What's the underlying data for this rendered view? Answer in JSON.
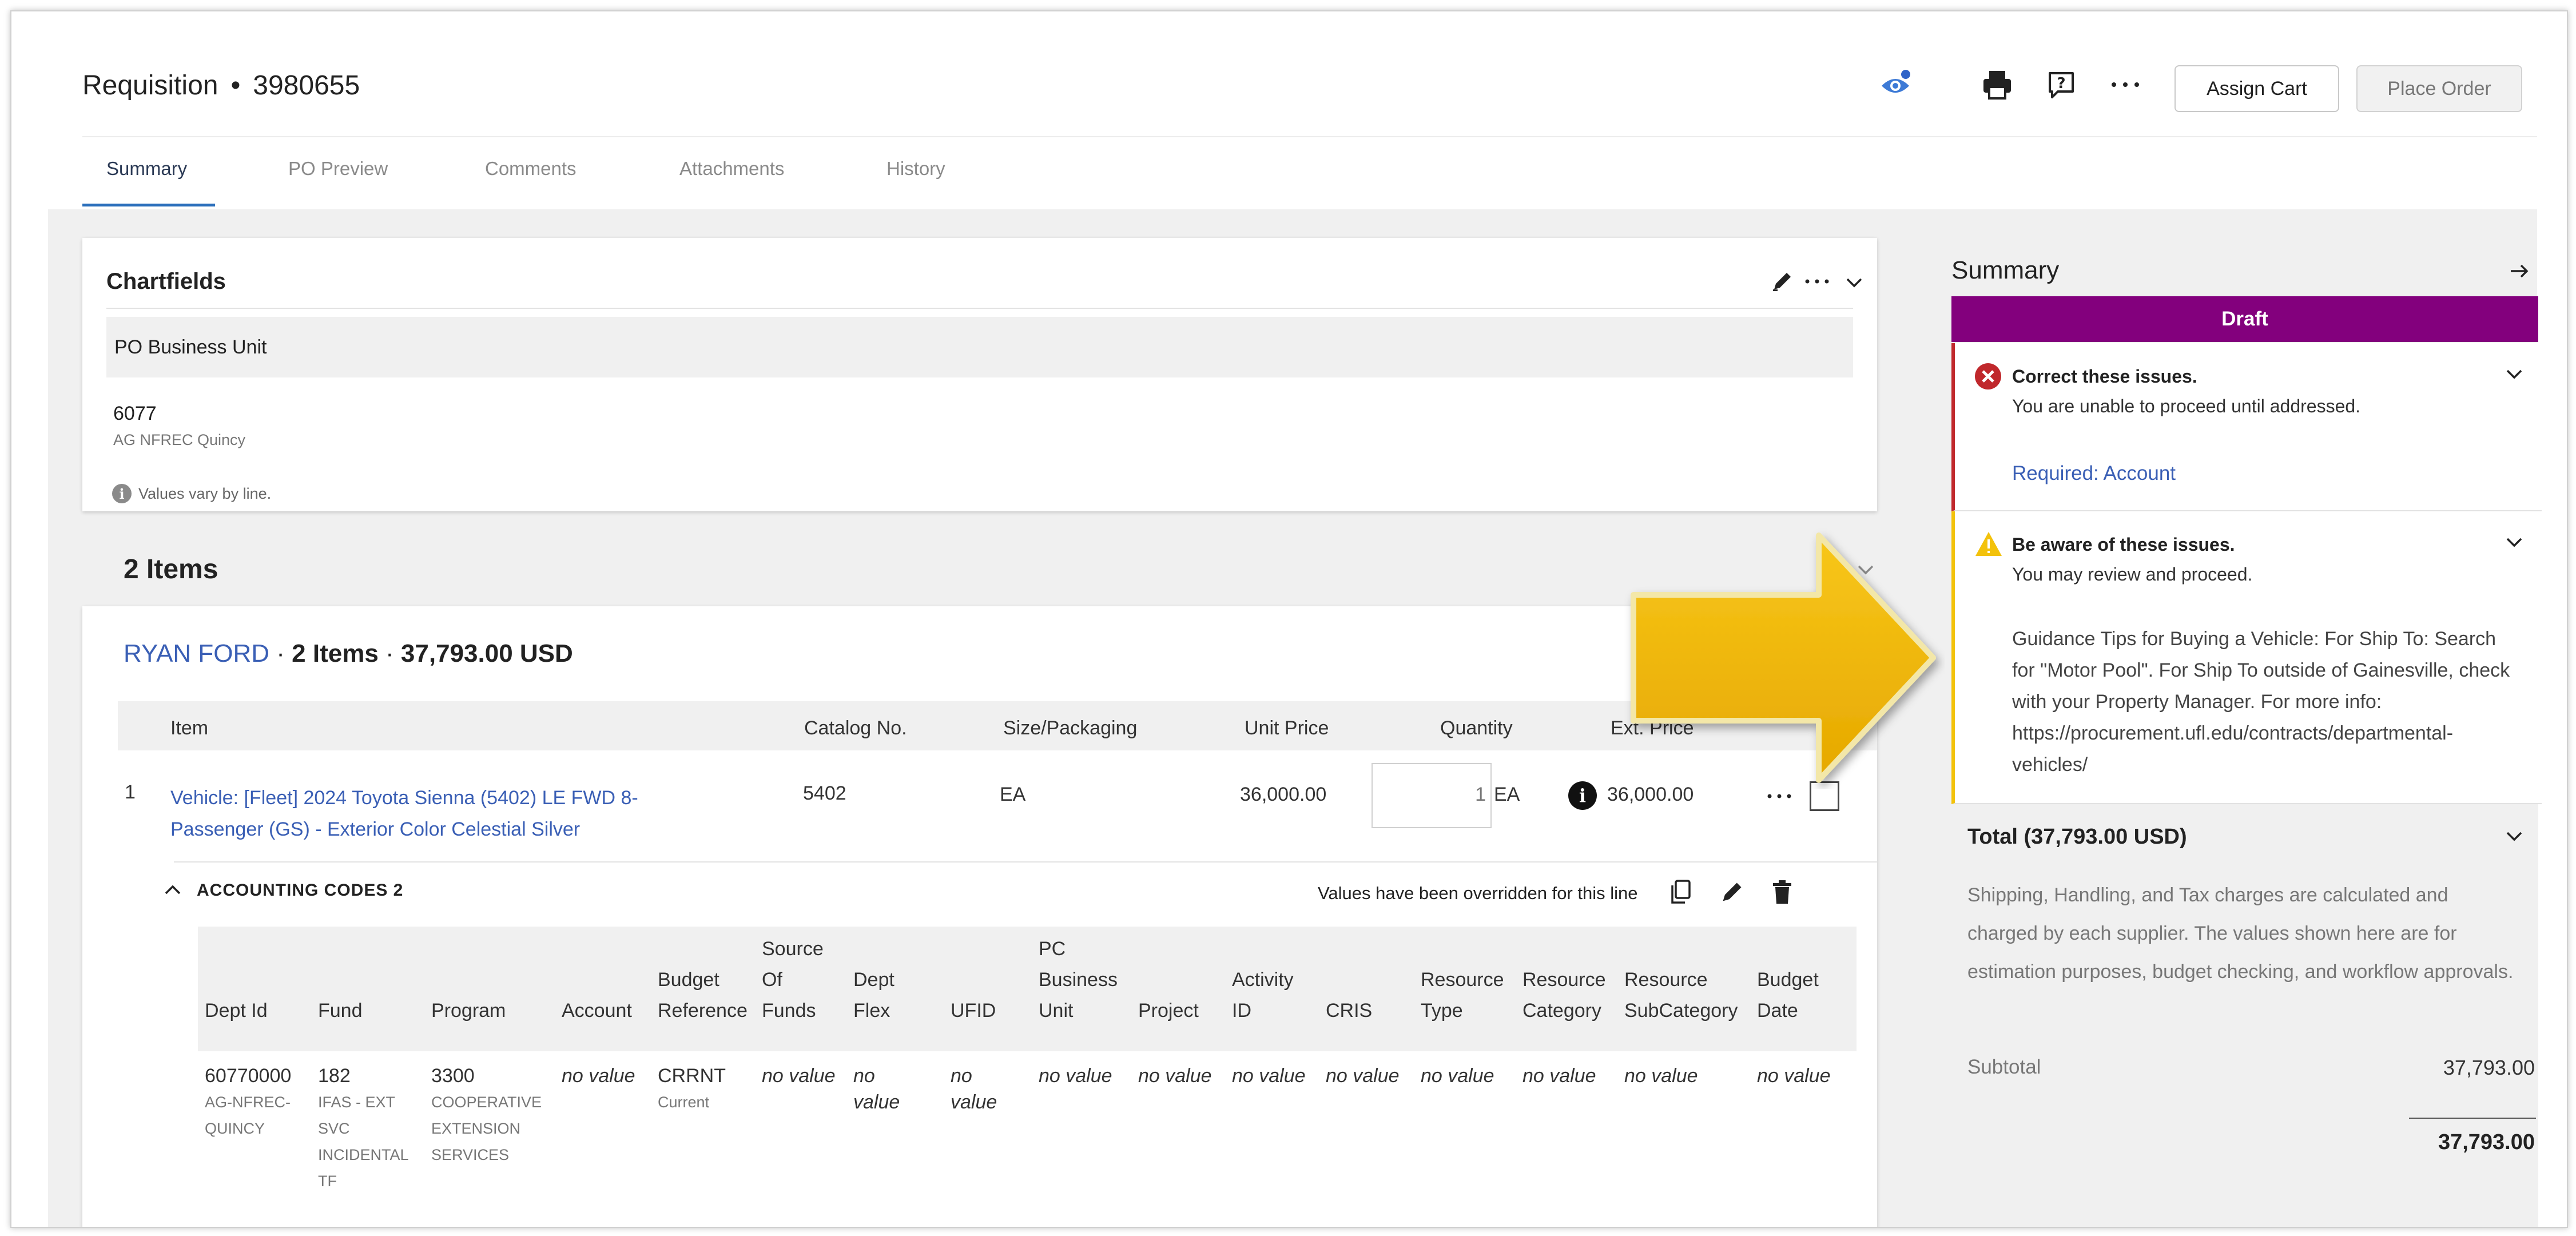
{
  "header": {
    "doc_type": "Requisition",
    "separator": "•",
    "doc_number": "3980655",
    "assign_cart_label": "Assign Cart",
    "place_order_label": "Place Order"
  },
  "tabs": [
    "Summary",
    "PO Preview",
    "Comments",
    "Attachments",
    "History"
  ],
  "chartfields": {
    "title": "Chartfields",
    "band_label": "PO Business Unit",
    "value": "6077",
    "value_desc": "AG NFREC Quincy",
    "note": "Values vary by line."
  },
  "items": {
    "heading": "2 Items",
    "supplier_name": "RYAN FORD",
    "supplier_sep1": " · ",
    "supplier_count": "2 Items",
    "supplier_sep2": " · ",
    "supplier_total": "37,793.00 USD",
    "columns": {
      "item": "Item",
      "catalog": "Catalog No.",
      "size": "Size/Packaging",
      "unit_price": "Unit Price",
      "quantity": "Quantity",
      "ext_price": "Ext. Price"
    },
    "rows": [
      {
        "num": "1",
        "name_line1": "Vehicle: [Fleet] 2024 Toyota Sienna (5402) LE FWD 8-",
        "name_line2": "Passenger (GS) - Exterior Color Celestial Silver",
        "catalog": "5402",
        "size": "EA",
        "unit_price": "36,000.00",
        "quantity": "1",
        "uom": "EA",
        "ext_price": "36,000.00"
      }
    ]
  },
  "accounting": {
    "title": "ACCOUNTING CODES 2",
    "note": "Values have been overridden for this line",
    "columns": {
      "dept_id": "Dept Id",
      "fund": "Fund",
      "program": "Program",
      "account": "Account",
      "budget_ref_1": "Budget",
      "budget_ref_2": "Reference",
      "source_1": "Source",
      "source_2": "Of",
      "source_3": "Funds",
      "dept_flex_1": "Dept",
      "dept_flex_2": "Flex",
      "ufid": "UFID",
      "pc_bu_1": "PC",
      "pc_bu_2": "Business",
      "pc_bu_3": "Unit",
      "project": "Project",
      "activity_1": "Activity",
      "activity_2": "ID",
      "cris": "CRIS",
      "res_type_1": "Resource",
      "res_type_2": "Type",
      "res_cat_1": "Resource",
      "res_cat_2": "Category",
      "res_sub_1": "Resource",
      "res_sub_2": "SubCategory",
      "budget_date_1": "Budget",
      "budget_date_2": "Date"
    },
    "row": {
      "dept_id": "60770000",
      "dept_desc_1": "AG-NFREC-",
      "dept_desc_2": "QUINCY",
      "fund": "182",
      "fund_desc_1": "IFAS - EXT",
      "fund_desc_2": "SVC",
      "fund_desc_3": "INCIDENTAL",
      "fund_desc_4": "TF",
      "program": "3300",
      "program_desc_1": "COOPERATIVE",
      "program_desc_2": "EXTENSION",
      "program_desc_3": "SERVICES",
      "account": "no value",
      "budget_ref": "CRRNT",
      "budget_ref_desc": "Current",
      "source": "no value",
      "dept_flex_1": "no",
      "dept_flex_2": "value",
      "ufid_1": "no",
      "ufid_2": "value",
      "pc_bu": "no value",
      "project": "no value",
      "activity": "no value",
      "cris": "no value",
      "res_type": "no value",
      "res_cat": "no value",
      "res_sub": "no value",
      "budget_date": "no value"
    }
  },
  "summary": {
    "title": "Summary",
    "status": "Draft",
    "error_heading": "Correct these issues.",
    "error_text": "You are unable to proceed until addressed.",
    "error_link": "Required: Account",
    "warn_heading": "Be aware of these issues.",
    "warn_text": "You may review and proceed.",
    "guidance": "Guidance Tips for Buying a Vehicle: For Ship To: Search for \"Motor Pool\". For Ship To outside of Gainesville, check with your Property Manager. For more info: https://procurement.ufl.edu/contracts/departmental-vehicles/",
    "total_heading": "Total (37,793.00 USD)",
    "total_text": "Shipping, Handling, and Tax charges are calculated and charged by each supplier. The values shown here are for estimation purposes, budget checking, and workflow approvals.",
    "subtotal_label": "Subtotal",
    "subtotal_value": "37,793.00",
    "total_value": "37,793.00"
  },
  "icons": {
    "watch": "eye-icon",
    "print": "printer-icon",
    "help": "help-icon",
    "more": "more-icon",
    "highlight_arrow": "arrow-annotation"
  },
  "colors": {
    "link": "#3a5fb5",
    "draft": "#83007d",
    "error": "#c0282c",
    "warning": "#f3c20b",
    "tab_active": "#2a6ebb"
  }
}
